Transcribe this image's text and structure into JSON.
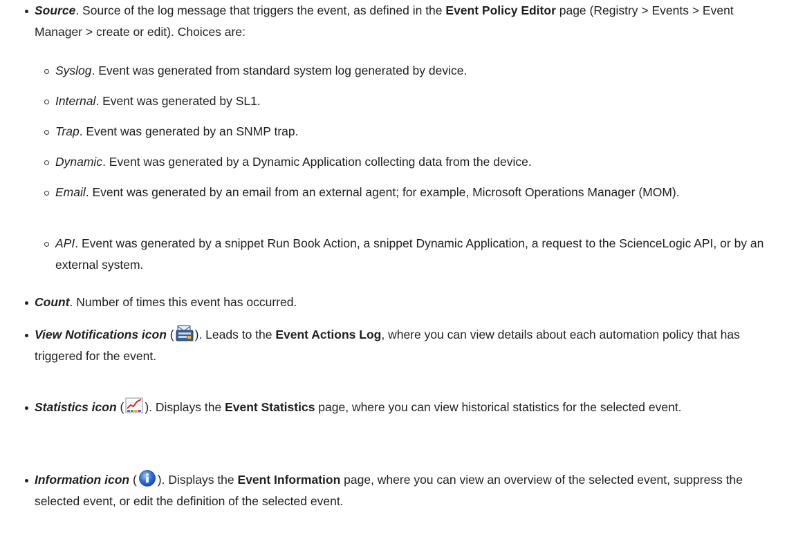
{
  "source": {
    "term": "Source",
    "text_a": ". Source of the log message that triggers the event, as defined in the ",
    "ui": "Event Policy Editor",
    "text_b": " page (Registry > Events > Event Manager > create or edit). Choices are:"
  },
  "source_choices": [
    {
      "term": "Syslog",
      "text": ". Event was generated from standard system log generated by device."
    },
    {
      "term": "Internal",
      "text": ". Event was generated by SL1."
    },
    {
      "term": "Trap",
      "text": ". Event was generated by an SNMP trap."
    },
    {
      "term": "Dynamic",
      "text": ". Event was generated by a Dynamic Application collecting data from the device."
    },
    {
      "term": "Email",
      "text": ". Event was generated by an email from an external agent; for example, Microsoft Operations Manager (MOM)."
    },
    {
      "term": "API",
      "text": ". Event was generated by a snippet Run Book Action, a snippet Dynamic Application, a request to the ScienceLogic API, or by an external system."
    }
  ],
  "count": {
    "term": "Count",
    "text": ". Number of times this event has occurred."
  },
  "view_notifications": {
    "term": "View Notifications icon",
    "open": " (",
    "close": "). Leads to the ",
    "ui": "Event Actions Log",
    "text": ", where you can view details about each automation policy that has triggered for the event."
  },
  "statistics": {
    "term": "Statistics icon",
    "open": " (",
    "close": "). Displays the ",
    "ui": "Event Statistics",
    "text": " page, where you can view historical statistics for the selected event."
  },
  "information": {
    "term": "Information icon",
    "open": " (",
    "close": "). Displays the ",
    "ui": "Event Information",
    "text": " page, where you can view an overview of the selected event, suppress the selected event, or edit the definition of the selected event."
  },
  "icons": {
    "view_notifications": "envelope-notifications-icon",
    "statistics": "statistics-chart-icon",
    "information": "info-circle-icon"
  },
  "colors": {
    "text": "#1f1f1f",
    "info_blue": "#2a6fdb",
    "chart_red": "#d8262a"
  }
}
